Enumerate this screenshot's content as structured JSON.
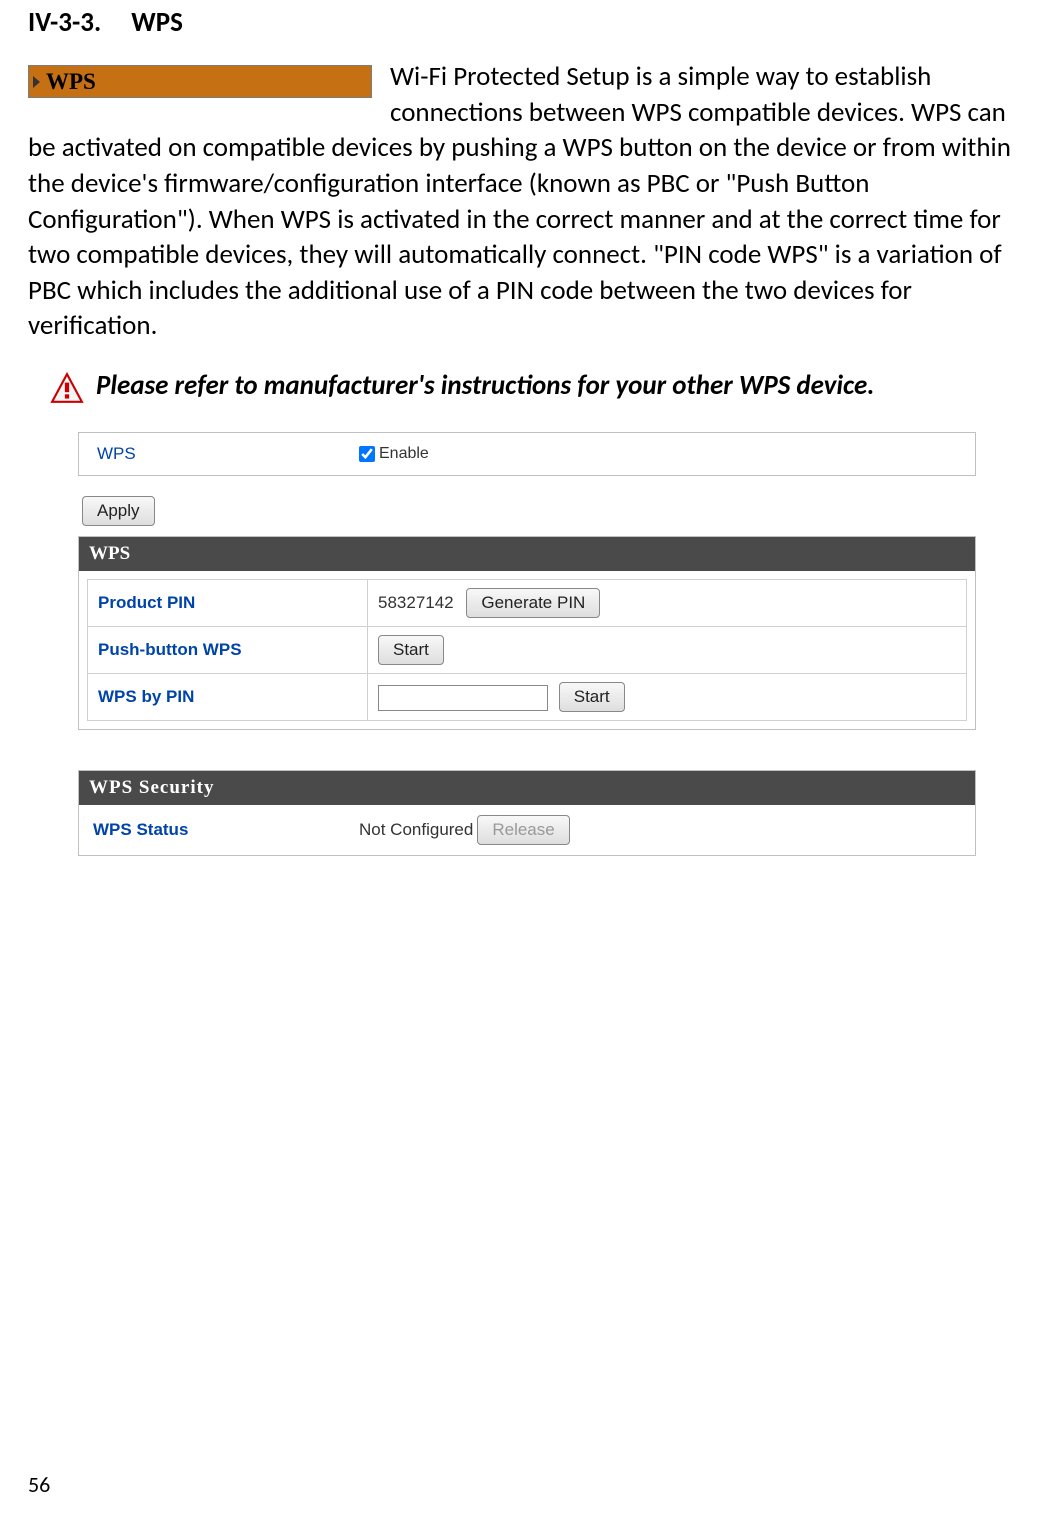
{
  "heading": {
    "number": "IV-3-3.",
    "title": "WPS"
  },
  "tab_label": "WPS",
  "intro_paragraph": "Wi-Fi Protected Setup is a simple way to establish connections between WPS compatible devices. WPS can be activated on compatible devices by pushing a WPS button on the device or from within the device's firmware/configuration interface (known as PBC or \"Push Button Configuration\"). When WPS is activated in the correct manner and at the correct time for two compatible devices, they will automatically connect. \"PIN code WPS\" is a variation of PBC which includes the additional use of a PIN code between the two devices for verification.",
  "warning_text": "Please refer to manufacturer's instructions for your other WPS device.",
  "ui": {
    "enable_section": {
      "label": "WPS",
      "checkbox_label": "Enable",
      "checked": true
    },
    "apply_button": "Apply",
    "wps_panel": {
      "title": "WPS",
      "rows": {
        "product_pin": {
          "label": "Product PIN",
          "value": "58327142",
          "button": "Generate PIN"
        },
        "push_button": {
          "label": "Push-button WPS",
          "button": "Start"
        },
        "wps_by_pin": {
          "label": "WPS by PIN",
          "input_value": "",
          "button": "Start"
        }
      }
    },
    "security_panel": {
      "title": "WPS Security",
      "status_label": "WPS Status",
      "status_value": "Not Configured",
      "release_button": "Release"
    }
  },
  "page_number": "56"
}
